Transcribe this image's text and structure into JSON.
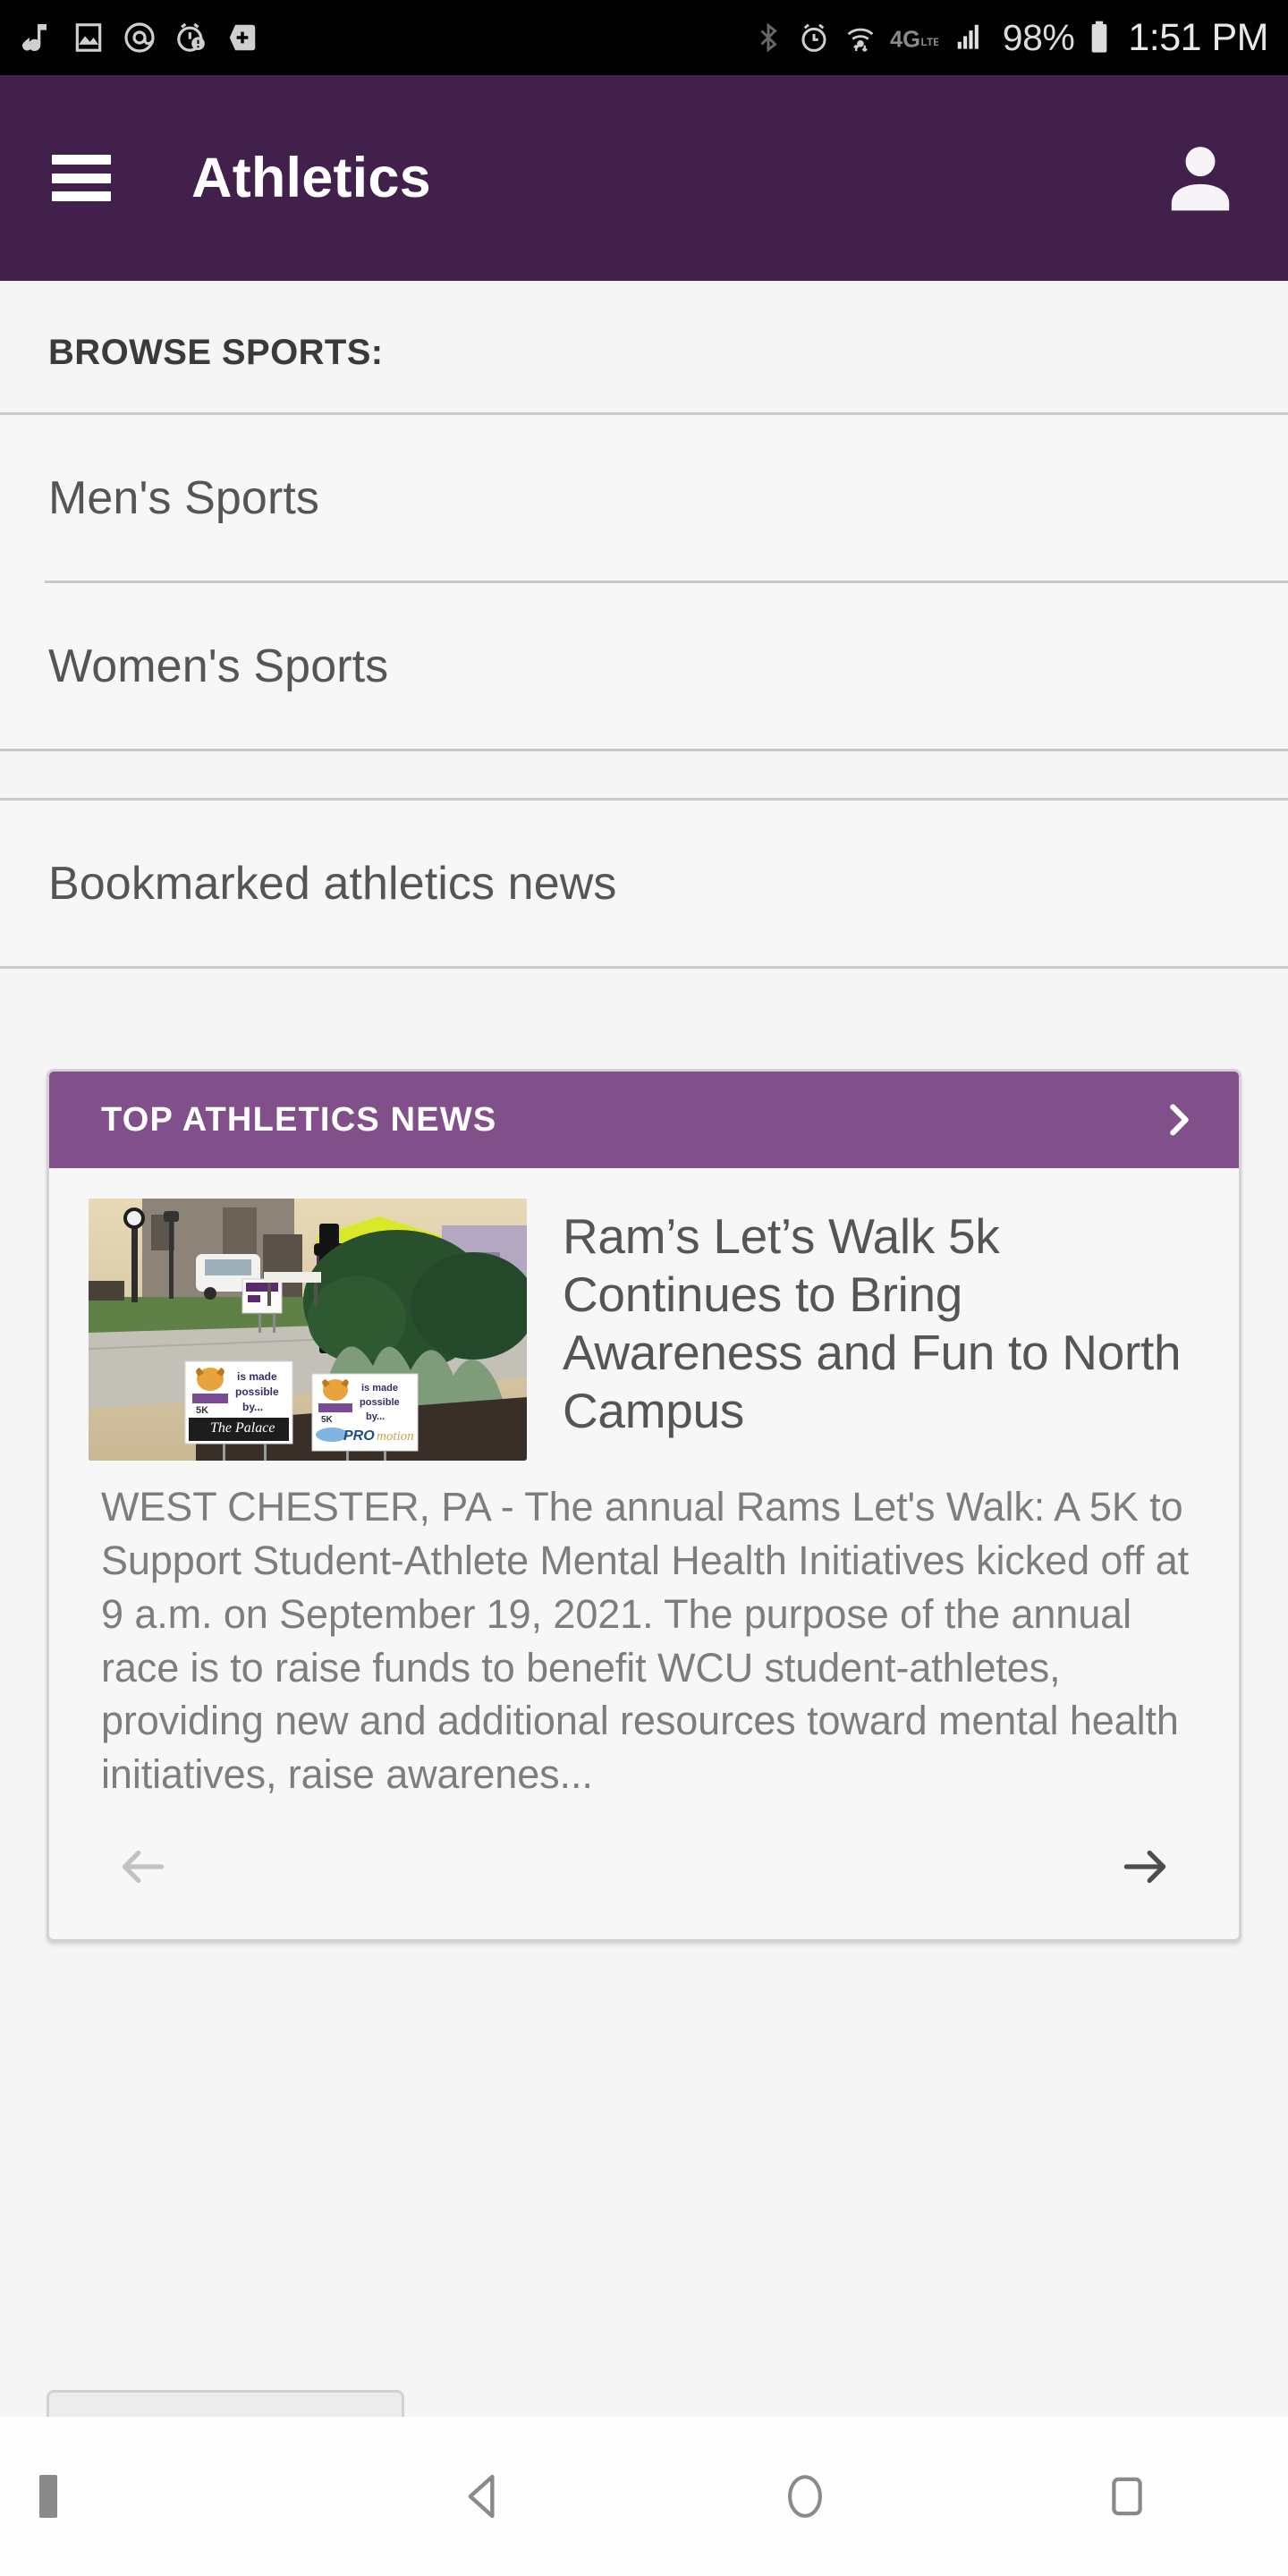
{
  "statusbar": {
    "left_icons": [
      "music-note-icon",
      "image-icon",
      "email-at-icon",
      "alarm-warning-icon",
      "add-box-icon"
    ],
    "right_icons": [
      "bluetooth-icon",
      "alarm-clock-icon",
      "wifi-icon",
      "4g-lte-icon",
      "signal-bars-icon"
    ],
    "battery_percent": "98%",
    "battery_icon": "battery-full-icon",
    "time": "1:51 PM"
  },
  "appbar": {
    "menu_icon": "hamburger-menu-icon",
    "title": "Athletics",
    "account_icon": "account-person-icon"
  },
  "browse": {
    "label": "BROWSE SPORTS:",
    "groups": [
      {
        "items": [
          {
            "label": "Men's Sports"
          },
          {
            "label": "Women's Sports"
          }
        ]
      },
      {
        "items": [
          {
            "label": "Bookmarked athletics news"
          }
        ]
      }
    ]
  },
  "news": {
    "header_title": "TOP ATHLETICS NEWS",
    "header_chevron_icon": "chevron-right-icon",
    "thumbnail_name": "article-thumbnail-rams-walk-signs",
    "headline": "Ram’s Let’s Walk 5k Continues to Bring Awareness and Fun to North Campus",
    "excerpt": "WEST CHESTER, PA - The annual Rams Let's Walk: A 5K to Support Student-Athlete Mental Health Initiatives kicked off at 9 a.m. on September 19, 2021. The purpose of the annual race is to raise funds to benefit WCU student-athletes, providing new and additional resources toward mental health initiatives, raise awarenes...",
    "prev_icon": "arrow-left-icon",
    "next_icon": "arrow-right-icon"
  },
  "navbar": {
    "dot_icon": "nav-indicator-dot",
    "back_icon": "back-triangle-icon",
    "home_icon": "home-circle-icon",
    "recents_icon": "recents-square-icon"
  },
  "colors": {
    "appbar_purple": "#42204c",
    "banner_purple": "#81508a",
    "page_bg": "#f5f5f5",
    "divider": "#c9c9c9",
    "text_body": "#7d7d7d",
    "text_headline": "#555555"
  }
}
